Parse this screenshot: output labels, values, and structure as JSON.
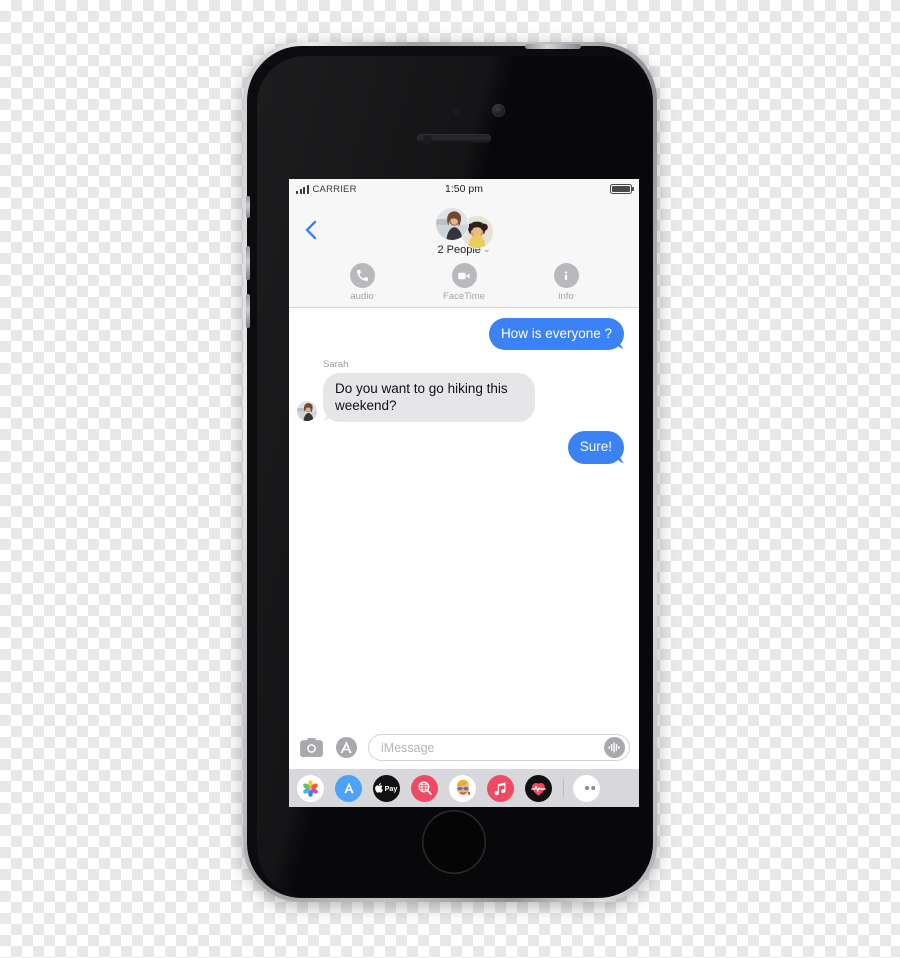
{
  "device": {
    "name": "iphone-5s-space-gray",
    "body_color": "#b6babd",
    "screen_bg": "#ffffff"
  },
  "status_bar": {
    "carrier": "CARRIER",
    "time": "1:50 pm",
    "signal_bars": 4,
    "battery_full": true
  },
  "nav_header": {
    "back_icon": "chevron-left-icon",
    "back_color": "#3b82f6",
    "people_label": "2 People",
    "people_chevron": "⌄",
    "avatar_count": 2,
    "actions": [
      {
        "label": "audio",
        "icon": "phone-icon"
      },
      {
        "label": "FaceTime",
        "icon": "video-camera-icon"
      },
      {
        "label": "info",
        "icon": "info-icon"
      }
    ]
  },
  "thread": {
    "messages": [
      {
        "id": 1,
        "direction": "outgoing",
        "text": "How is everyone ?",
        "sender": null
      },
      {
        "id": 2,
        "direction": "incoming",
        "text": "Do you want to go hiking this weekend?",
        "sender": "Sarah"
      },
      {
        "id": 3,
        "direction": "outgoing",
        "text": "Sure!",
        "sender": null
      }
    ],
    "bubble_colors": {
      "outgoing": "#3b82f6",
      "outgoing_text": "#ffffff",
      "incoming": "#e6e6e8",
      "incoming_text": "#111113"
    }
  },
  "input_bar": {
    "camera_icon": "camera-icon",
    "appstore_icon": "app-store-icon",
    "placeholder": "iMessage",
    "value": "",
    "audio_icon": "audio-waveform-icon"
  },
  "app_drawer": {
    "apps": [
      {
        "name": "photos",
        "icon": "photos-icon",
        "bg": "#ffffff"
      },
      {
        "name": "app-store",
        "icon": "app-store-icon",
        "bg": "#4da2f5"
      },
      {
        "name": "apple-pay",
        "icon": "apple-pay-icon",
        "bg": "#111111"
      },
      {
        "name": "images-search",
        "icon": "images-search-icon",
        "bg": "#ef4a63"
      },
      {
        "name": "memoji",
        "icon": "memoji-icon",
        "bg": "#ffffff"
      },
      {
        "name": "music",
        "icon": "music-note-icon",
        "bg": "#ef4a63"
      },
      {
        "name": "digital-touch",
        "icon": "heartbeat-icon",
        "bg": "#111111"
      },
      {
        "name": "more",
        "icon": "more-apps-icon",
        "bg": "#ffffff"
      }
    ]
  }
}
